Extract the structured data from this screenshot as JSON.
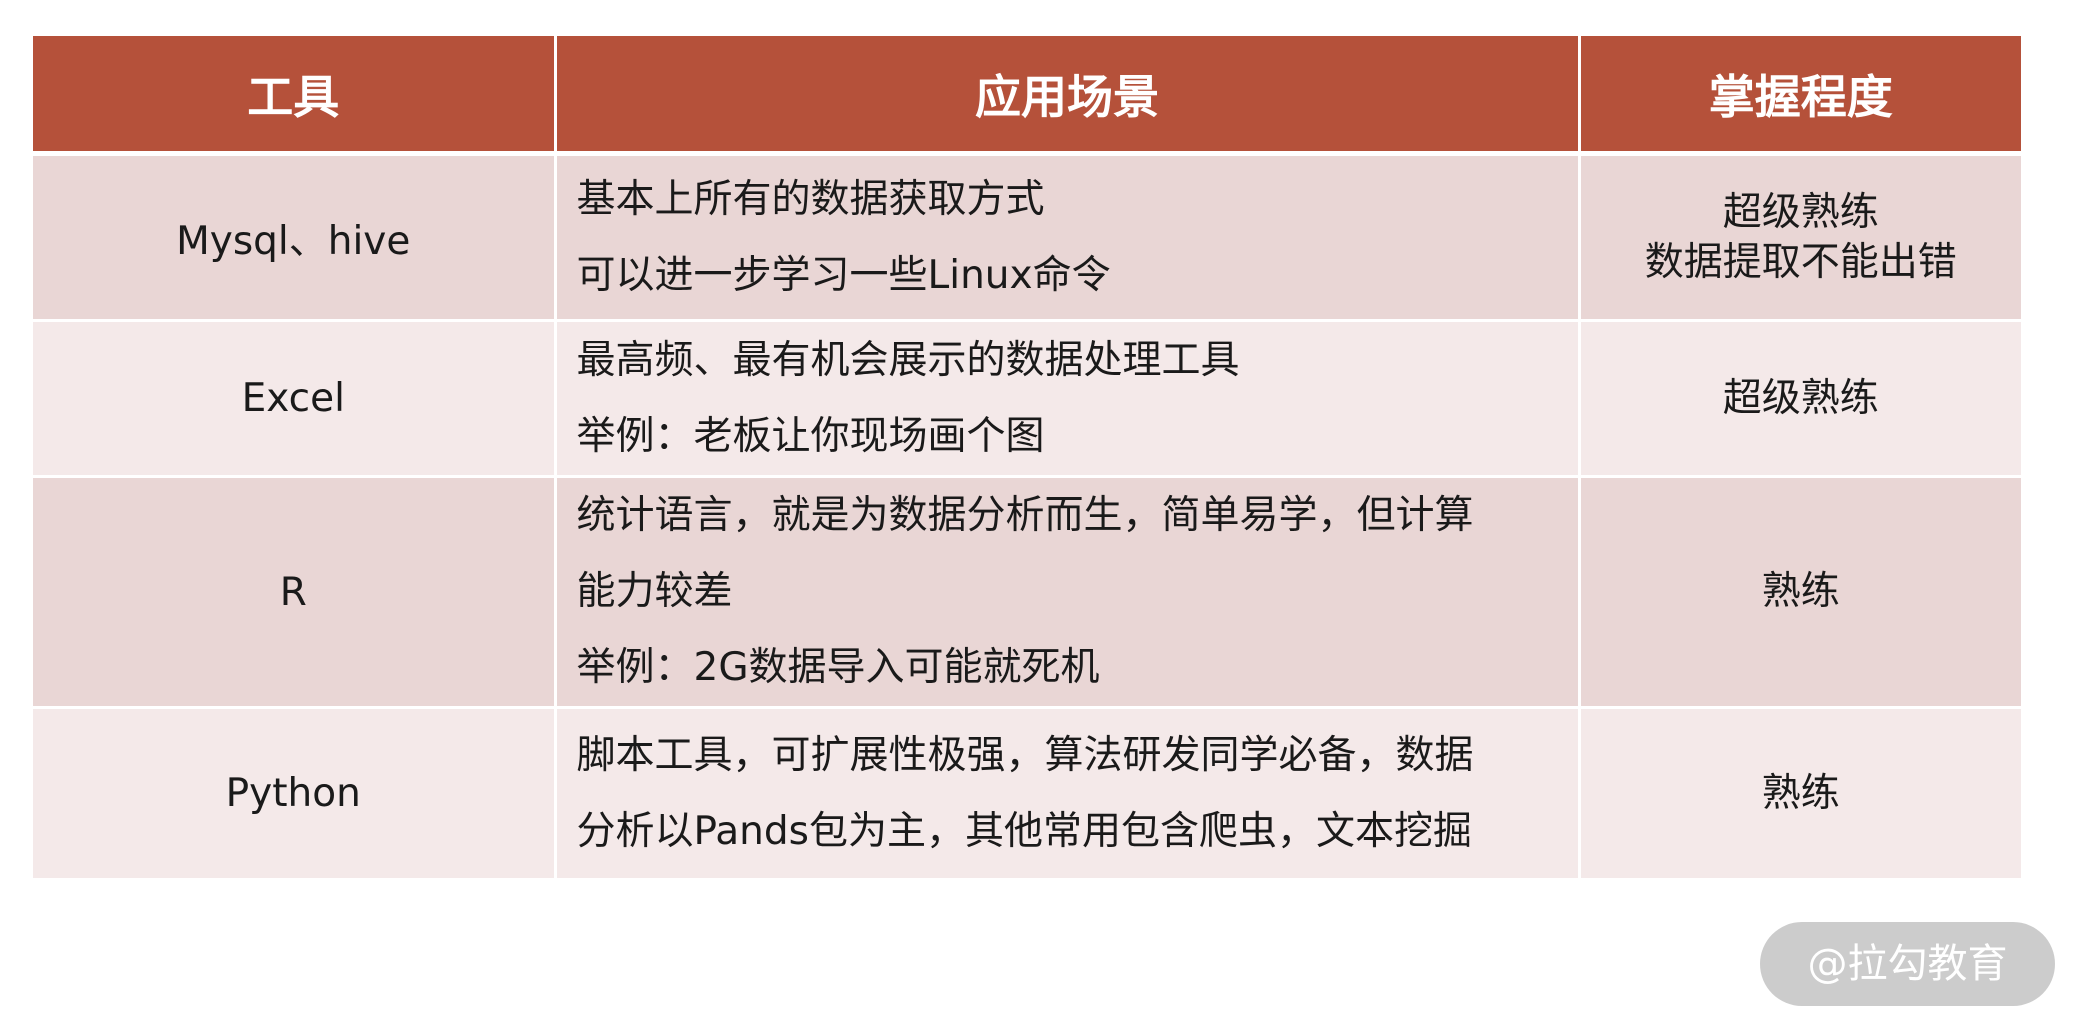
{
  "table": {
    "headers": [
      "工具",
      "应用场景",
      "掌握程度"
    ],
    "rows": [
      {
        "tool": "Mysql、hive",
        "scene": [
          "基本上所有的数据获取方式",
          "可以进一步学习一些Linux命令"
        ],
        "level": [
          "超级熟练",
          "数据提取不能出错"
        ]
      },
      {
        "tool": "Excel",
        "scene": [
          "最高频、最有机会展示的数据处理工具",
          "举例：老板让你现场画个图"
        ],
        "level": [
          "超级熟练"
        ]
      },
      {
        "tool": "R",
        "scene": [
          "统计语言，就是为数据分析而生，简单易学，但计算",
          "能力较差",
          "举例：2G数据导入可能就死机"
        ],
        "level": [
          "熟练"
        ]
      },
      {
        "tool": "Python",
        "scene": [
          "脚本工具，可扩展性极强，算法研发同学必备，数据",
          "分析以Pands包为主，其他常用包含爬虫，文本挖掘"
        ],
        "level": [
          "熟练"
        ]
      }
    ]
  },
  "watermark": {
    "text": "@拉勾教育"
  },
  "colors": {
    "header_bg": "#b5513a",
    "row_odd_bg": "#e9d6d5",
    "row_even_bg": "#f4e9e9"
  }
}
